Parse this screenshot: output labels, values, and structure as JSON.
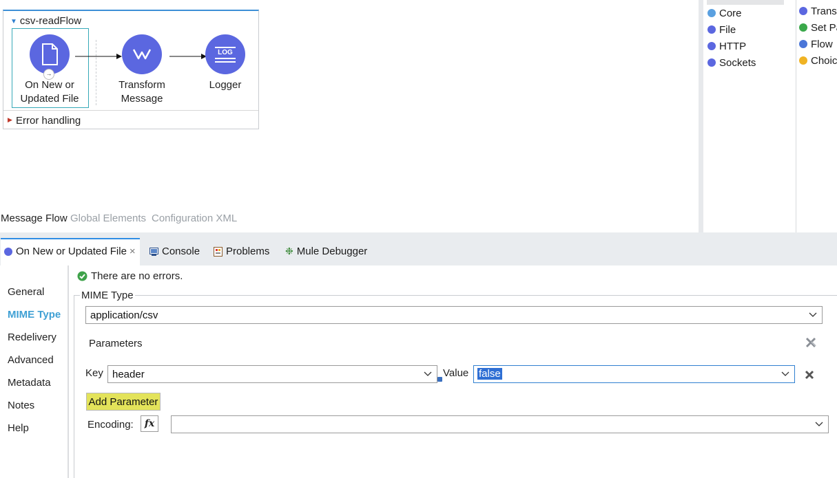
{
  "flow": {
    "name": "csv-readFlow",
    "nodes": [
      {
        "label_line1": "On New or",
        "label_line2": "Updated File",
        "icon": "file-icon"
      },
      {
        "label_line1": "Transform",
        "label_line2": "Message",
        "icon": "dataweave-icon"
      },
      {
        "label_line1": "Logger",
        "label_line2": "",
        "icon": "log-icon",
        "icon_text": "LOG"
      }
    ],
    "error_handling": "Error handling"
  },
  "editor_tabs": [
    "Message Flow",
    "Global Elements",
    "Configuration XML"
  ],
  "palette": {
    "modules": [
      {
        "label": "Core",
        "icon": "core-icon",
        "color": "#5aa0e0"
      },
      {
        "label": "File",
        "icon": "file-icon",
        "color": "#5b67e0"
      },
      {
        "label": "HTTP",
        "icon": "http-icon",
        "color": "#5b67e0"
      },
      {
        "label": "Sockets",
        "icon": "sockets-icon",
        "color": "#5b67e0"
      }
    ],
    "operations": [
      {
        "label": "Trans",
        "icon": "transform-icon",
        "color": "#5b67e0"
      },
      {
        "label": "Set Pa",
        "icon": "set-payload-icon",
        "color": "#3aa84a"
      },
      {
        "label": "Flow",
        "icon": "flow-ref-icon",
        "color": "#4a76d8"
      },
      {
        "label": "Choic",
        "icon": "choice-icon",
        "color": "#f0b323"
      }
    ]
  },
  "bottom_tabs": [
    {
      "label": "On New or Updated File",
      "icon": "file-icon",
      "closable": true
    },
    {
      "label": "Console",
      "icon": "console-icon"
    },
    {
      "label": "Problems",
      "icon": "problems-icon"
    },
    {
      "label": "Mule Debugger",
      "icon": "debug-icon"
    }
  ],
  "nav": [
    "General",
    "MIME Type",
    "Redelivery",
    "Advanced",
    "Metadata",
    "Notes",
    "Help"
  ],
  "status": "There are no errors.",
  "mime": {
    "group_label": "MIME Type",
    "mime_type": "application/csv",
    "parameters_label": "Parameters",
    "key_label": "Key",
    "key_value": "header",
    "value_label": "Value",
    "value_value": "false",
    "add_parameter": "Add Parameter",
    "encoding_label": "Encoding:",
    "encoding_value": "",
    "fx": "fx"
  },
  "colors": {
    "accent": "#2f8de4",
    "node": "#5b67e0",
    "selection": "#35a8b8",
    "highlight": "#e3e35a"
  }
}
